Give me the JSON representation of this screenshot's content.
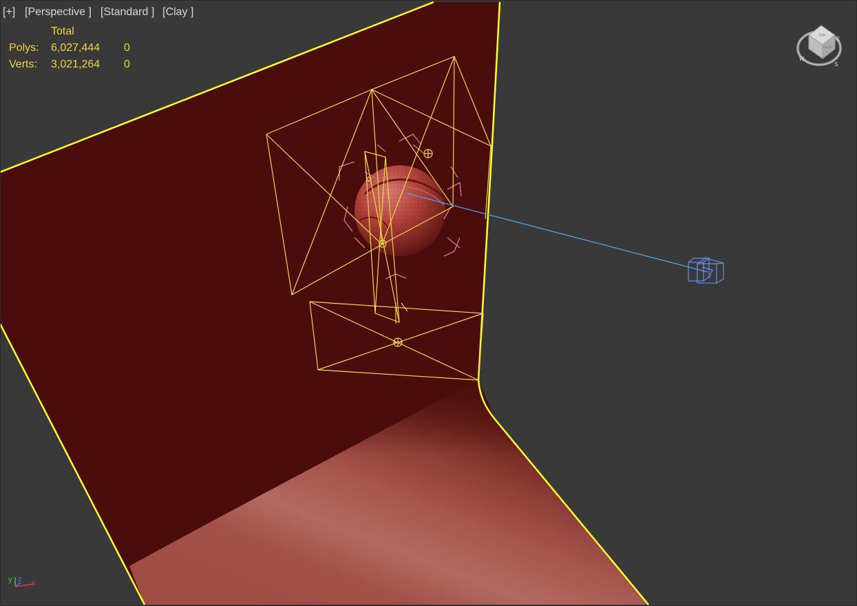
{
  "viewport": {
    "labels": {
      "plus": "[+]",
      "perspective": "[Perspective ]",
      "standard": "[Standard ]",
      "shading": "[Clay ]"
    },
    "stats": {
      "header": "Total",
      "rows": [
        {
          "label": "Polys:",
          "total": "6,027,444",
          "selected": "0"
        },
        {
          "label": "Verts:",
          "total": "3,021,264",
          "selected": "0"
        }
      ]
    },
    "viewcube": {
      "top_face": "TOP",
      "front_face": "FRONT",
      "compass": {
        "west": "W",
        "south": "S",
        "east": "E"
      }
    },
    "axis_tripod": {
      "x": "x",
      "y": "y",
      "z": "z"
    }
  },
  "colors": {
    "background": "#393939",
    "selection": "#ffff2e",
    "backdrop_wall": "#4a0d0c",
    "backdrop_floor": "#a24f48",
    "ball": "#a0302c",
    "light_gizmo": "#f0d84a",
    "helper_pink": "#e070a0",
    "camera_blue": "#6a8ef0",
    "target_line": "#4aa4ee",
    "stats_text": "#f2d43c"
  },
  "icons": {
    "viewcube": "viewcube-icon",
    "axis": "axis-tripod-icon",
    "camera": "camera-icon"
  }
}
